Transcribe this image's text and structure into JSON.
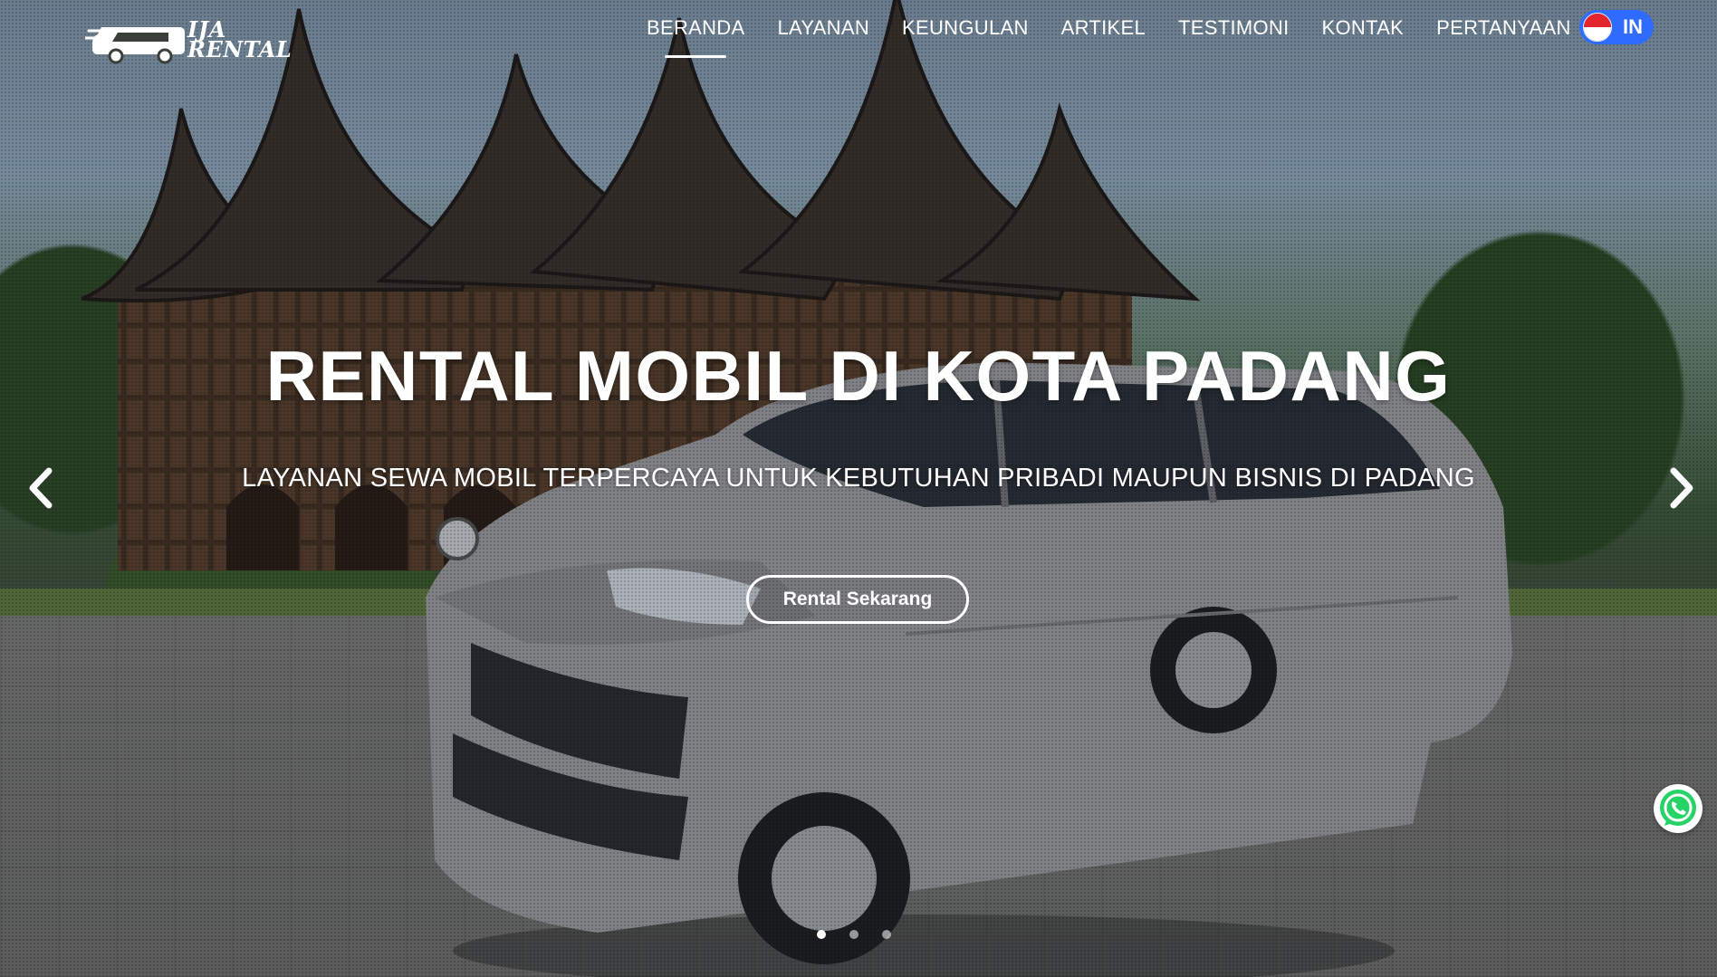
{
  "brand": {
    "logo_line1": "IJA",
    "logo_line2": "RENTAL"
  },
  "nav": {
    "items": [
      {
        "label": "BERANDA",
        "active": true
      },
      {
        "label": "LAYANAN"
      },
      {
        "label": "KEUNGULAN"
      },
      {
        "label": "ARTIKEL"
      },
      {
        "label": "TESTIMONI"
      },
      {
        "label": "KONTAK"
      },
      {
        "label": "PERTANYAAN"
      }
    ],
    "language": {
      "code": "IN"
    }
  },
  "hero": {
    "title": "RENTAL MOBIL DI KOTA PADANG",
    "subtitle": "LAYANAN SEWA MOBIL TERPERCAYA UNTUK KEBUTUHAN PRIBADI MAUPUN BISNIS DI PADANG",
    "cta_label": "Rental Sekarang",
    "slides": 3,
    "active_slide": 1
  },
  "icons": {
    "prev": "chevron-left-icon",
    "next": "chevron-right-icon",
    "whatsapp": "whatsapp-icon",
    "flag": "indonesia-flag-icon"
  },
  "colors": {
    "lang_button": "#2f6bff",
    "whatsapp": "#25d366"
  }
}
